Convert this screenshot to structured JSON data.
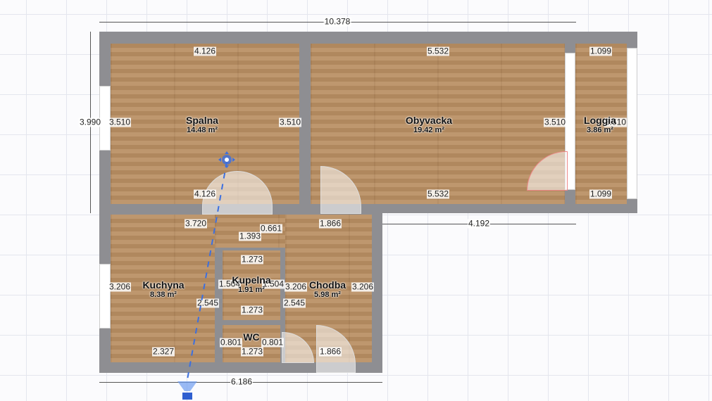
{
  "rooms": [
    {
      "name": "Spalna",
      "area": "14.48 m²"
    },
    {
      "name": "Obyvacka",
      "area": "19.42 m²"
    },
    {
      "name": "Loggia",
      "area": "3.86 m²"
    },
    {
      "name": "Kuchyna",
      "area": "8.38 m²"
    },
    {
      "name": "Kupelna",
      "area": "1.91 m²"
    },
    {
      "name": "Chodba",
      "area": "5.98 m²"
    },
    {
      "name": "WC"
    }
  ],
  "dimensions": {
    "total_width": "10.378",
    "total_height": "3.990",
    "lower_width": "6.186",
    "right_offset": "4.192",
    "spalna_w": "4.126",
    "spalna_w_bottom": "4.126",
    "spalna_h_left": "3.510",
    "spalna_h_right": "3.510",
    "obyvacka_w": "5.532",
    "obyvacka_w_bottom": "5.532",
    "obyvacka_h": "3.510",
    "loggia_w": "1.099",
    "loggia_w_bottom": "1.099",
    "loggia_h": "3.510",
    "kuchyna_w": "3.720",
    "kuchyna_w_bottom": "2.327",
    "kuchyna_h": "3.206",
    "kuchyna_h_right": "2.545",
    "bath_top": "1.393",
    "bath_gap": "0.661",
    "kupelna_w": "1.273",
    "kupelna_w_bottom": "1.273",
    "kupelna_h_left": "1.504",
    "kupelna_h_right": "1.504",
    "wc_w": "1.273",
    "wc_h_left": "0.801",
    "wc_h_right": "0.801",
    "chodba_w": "1.866",
    "chodba_w_bottom": "1.866",
    "chodba_h_left": "3.206",
    "chodba_h_right": "3.206",
    "chodba_h_inner": "2.545"
  },
  "colors": {
    "wall": "#8e8e92",
    "floor": "#b98f63",
    "selection": "#3b6fe0"
  }
}
